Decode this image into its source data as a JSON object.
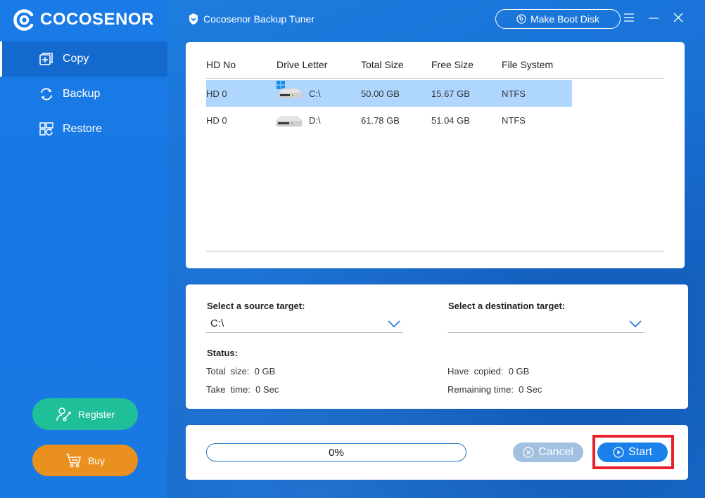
{
  "brand": {
    "name": "COCOSENOR"
  },
  "titlebar": {
    "app_title": "Cocosenor Backup Tuner",
    "boot_disk_label": "Make Boot Disk",
    "menu_icon": "hamburger-menu-icon",
    "minimize_icon": "minimize-icon",
    "close_icon": "close-icon"
  },
  "sidebar": {
    "items": [
      {
        "label": "Copy",
        "icon": "copy-icon",
        "active": true
      },
      {
        "label": "Backup",
        "icon": "sync-icon",
        "active": false
      },
      {
        "label": "Restore",
        "icon": "restore-icon",
        "active": false
      }
    ],
    "register_label": "Register",
    "buy_label": "Buy"
  },
  "drives": {
    "columns": [
      "HD No",
      "Drive Letter",
      "Total Size",
      "Free Size",
      "File System"
    ],
    "rows": [
      {
        "hd": "HD 0",
        "letter": "C:\\",
        "total": "50.00 GB",
        "free": "15.67 GB",
        "fs": "NTFS",
        "system": true,
        "selected": true
      },
      {
        "hd": "HD 0",
        "letter": "D:\\",
        "total": "61.78 GB",
        "free": "51.04 GB",
        "fs": "NTFS",
        "system": false,
        "selected": false
      }
    ]
  },
  "selection": {
    "source_label": "Select a source target:",
    "source_value": "C:\\",
    "destination_label": "Select a destination target:",
    "destination_value": ""
  },
  "status": {
    "label": "Status:",
    "total_size": "Total  size:  0 GB",
    "take_time": "Take  time:  0 Sec",
    "have_copied": "Have  copied:  0 GB",
    "remaining_time": "Remaining time:  0 Sec"
  },
  "progress": {
    "text": "0%",
    "value": 0
  },
  "actions": {
    "cancel_label": "Cancel",
    "start_label": "Start",
    "cancel_enabled": false
  },
  "colors": {
    "accent": "#1a7be6",
    "selected_row": "#aed6ff",
    "register": "#1fbf9a",
    "buy": "#e9901f",
    "highlight": "#e8202a"
  }
}
